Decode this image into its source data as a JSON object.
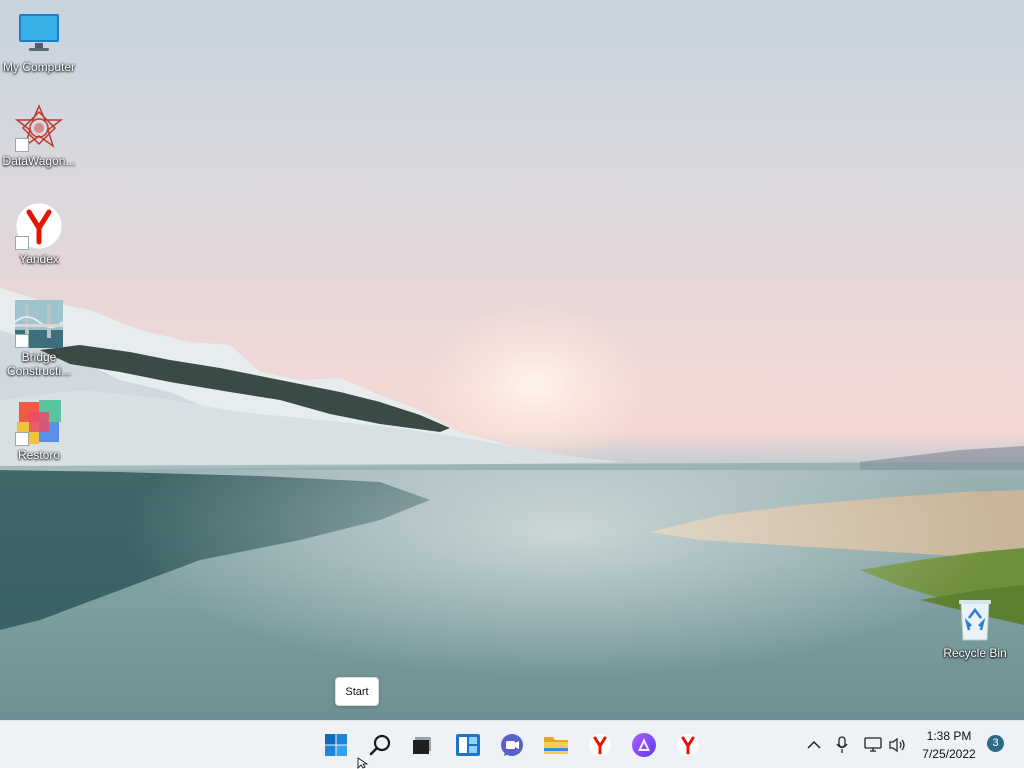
{
  "desktop": {
    "icons": [
      {
        "label": "My Computer",
        "icon": "monitor-icon"
      },
      {
        "label": "DataWagon...",
        "icon": "datawagon-icon"
      },
      {
        "label": "Yandex",
        "icon": "yandex-icon"
      },
      {
        "label": "Bridge Constructi...",
        "icon": "bridge-construction-icon"
      },
      {
        "label": "Restoro",
        "icon": "restoro-icon"
      },
      {
        "label": "Recycle Bin",
        "icon": "recycle-bin-icon"
      }
    ]
  },
  "tooltip": {
    "text": "Start"
  },
  "taskbar": {
    "items": [
      {
        "name": "start",
        "icon": "windows-logo-icon"
      },
      {
        "name": "search",
        "icon": "search-icon"
      },
      {
        "name": "task-view",
        "icon": "task-view-icon"
      },
      {
        "name": "widgets",
        "icon": "widgets-icon"
      },
      {
        "name": "chat",
        "icon": "teams-chat-icon"
      },
      {
        "name": "file-explorer",
        "icon": "folder-icon"
      },
      {
        "name": "yandex-browser",
        "icon": "yandex-icon"
      },
      {
        "name": "alice",
        "icon": "alice-icon"
      },
      {
        "name": "yandex",
        "icon": "yandex-icon"
      }
    ],
    "tray": {
      "chevron": "chevron-up-icon",
      "mic": "microphone-icon",
      "network": "network-icon",
      "volume": "volume-icon"
    },
    "clock": {
      "time": "1:38 PM",
      "date": "7/25/2022"
    },
    "notifications": "3"
  },
  "colors": {
    "accent": "#0078d4",
    "yandex_red": "#e61400",
    "alice_purple": "#8a4cf5"
  }
}
